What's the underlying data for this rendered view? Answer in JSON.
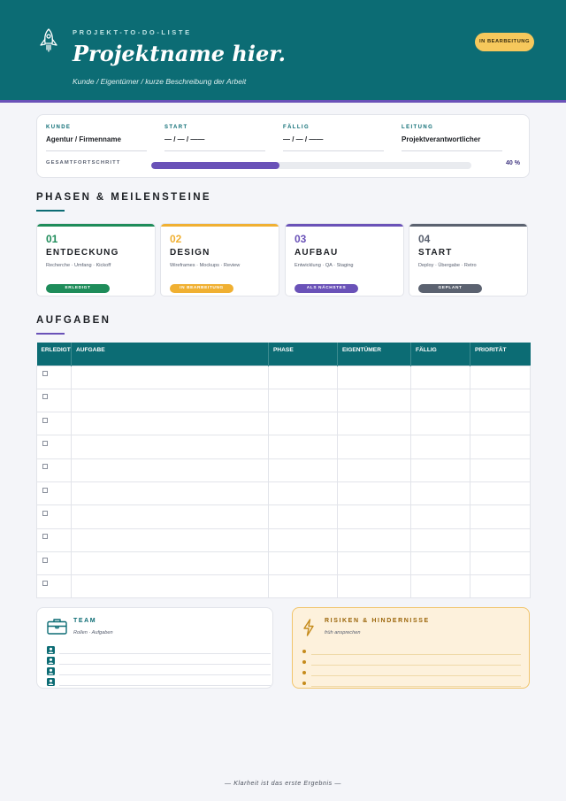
{
  "header": {
    "kicker": "PROJEKT-TO-DO-LISTE",
    "title": "Projektname hier.",
    "subtitle": "Kunde / Eigentümer / kurze Beschreibung der Arbeit",
    "status_badge": "IN BEARBEITUNG",
    "icon": "rocket-icon"
  },
  "info": {
    "fields": [
      {
        "label": "KUNDE",
        "value": "Agentur / Firmenname"
      },
      {
        "label": "START",
        "value": "— / — / ——"
      },
      {
        "label": "FÄLLIG",
        "value": "— / — / ——"
      },
      {
        "label": "LEITUNG",
        "value": "Projektverantwortlicher"
      }
    ],
    "progress_label": "GESAMTFORTSCHRITT",
    "progress_value": "40 %",
    "progress_fraction": 0.4
  },
  "phases": {
    "title": "PHASEN & MEILENSTEINE",
    "items": [
      {
        "num": "01",
        "name": "ENTDECKUNG",
        "tags": "Recherche · Umfang · Kickoff",
        "status": "ERLEDIGT",
        "color": "#1e8c5a"
      },
      {
        "num": "02",
        "name": "DESIGN",
        "tags": "Wireframes · Mockups · Review",
        "status": "IN BEARBEITUNG",
        "color": "#f0b032"
      },
      {
        "num": "03",
        "name": "AUFBAU",
        "tags": "Entwicklung · QA · Staging",
        "status": "ALS NÄCHSTES",
        "color": "#6a52b8"
      },
      {
        "num": "04",
        "name": "START",
        "tags": "Deploy · Übergabe · Retro",
        "status": "GEPLANT",
        "color": "#5b6270"
      }
    ]
  },
  "tasks": {
    "title": "AUFGABEN",
    "columns": [
      "ERLEDIGT",
      "AUFGABE",
      "PHASE",
      "EIGENTÜMER",
      "FÄLLIG",
      "PRIORITÄT"
    ],
    "row_count": 10
  },
  "team": {
    "title": "TEAM",
    "subtitle": "Rollen · Aufgaben",
    "icon": "briefcase-icon",
    "rows": 4
  },
  "risks": {
    "title": "RISIKEN & HINDERNISSE",
    "subtitle": "früh ansprechen",
    "icon": "lightning-icon",
    "rows": 4
  },
  "footer": "— Klarheit ist das erste Ergebnis —",
  "colors": {
    "brand": "#0c6c74",
    "accent": "#6a52b8",
    "badge": "#f6c85c",
    "risk_bg": "#fdf1dc"
  }
}
